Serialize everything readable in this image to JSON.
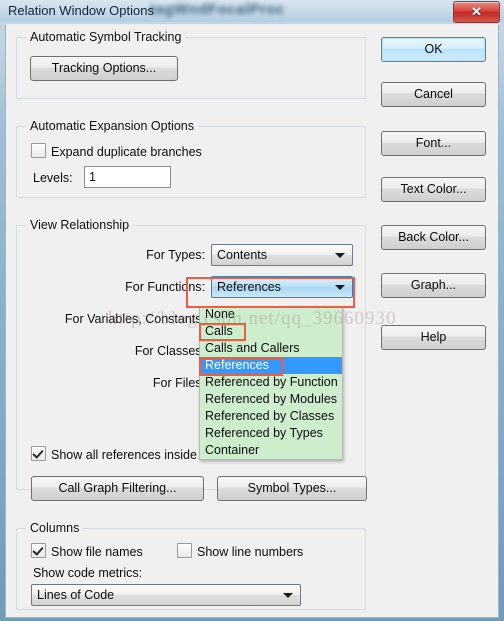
{
  "window": {
    "title": "Relation Window Options",
    "close_label": "✕",
    "backdrop_text": "tagWndFocalProc"
  },
  "watermark": "http://blog.csdn.net/qq_39660930",
  "groups": {
    "tracking": {
      "title": "Automatic Symbol Tracking",
      "tracking_options_button": "Tracking Options..."
    },
    "expansion": {
      "title": "Automatic Expansion Options",
      "expand_duplicate_label": "Expand duplicate branches",
      "expand_duplicate_checked": false,
      "levels_label": "Levels:",
      "levels_value": "1"
    },
    "view_relationship": {
      "title": "View Relationship",
      "for_types_label": "For Types:",
      "for_types_value": "Contents",
      "for_functions_label": "For Functions:",
      "for_functions_value": "References",
      "for_variables_label": "For Variables, Constants:",
      "for_classes_label": "For Classes:",
      "for_files_label": "For Files:",
      "show_all_references_label": "Show all references inside e",
      "show_all_references_checked": true,
      "call_graph_filtering_button": "Call Graph Filtering...",
      "symbol_types_button": "Symbol Types..."
    },
    "columns": {
      "title": "Columns",
      "show_file_names_label": "Show file names",
      "show_file_names_checked": true,
      "show_line_numbers_label": "Show line numbers",
      "show_line_numbers_checked": false,
      "show_code_metrics_label": "Show code metrics:",
      "code_metrics_value": "Lines of Code"
    }
  },
  "dropdown": {
    "open": true,
    "selected_index": 3,
    "items": [
      "None",
      "Calls",
      "Calls and Callers",
      "References",
      "Referenced by Function",
      "Referenced by Modules",
      "Referenced by Classes",
      "Referenced by Types",
      "Container"
    ]
  },
  "buttons": {
    "ok": "OK",
    "cancel": "Cancel",
    "font": "Font...",
    "text_color": "Text Color...",
    "back_color": "Back Color...",
    "graph": "Graph...",
    "help": "Help"
  },
  "colors": {
    "accent": "#3399ff",
    "annotation": "#ef5b43",
    "dropdown_bg": "#cdedcd",
    "dialog_bg": "#f0f0f0"
  }
}
